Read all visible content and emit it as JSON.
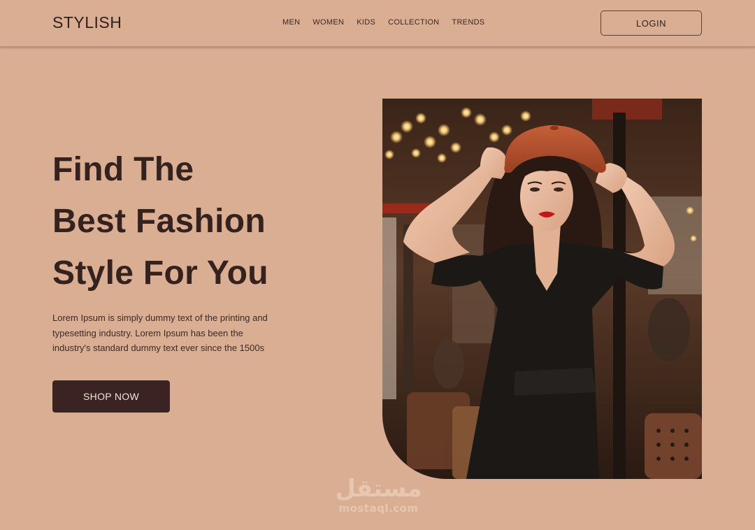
{
  "header": {
    "logo": "STYLISH",
    "nav": [
      {
        "label": "MEN"
      },
      {
        "label": "WOMEN"
      },
      {
        "label": "KIDS"
      },
      {
        "label": "COLLECTION"
      },
      {
        "label": "TRENDS"
      }
    ],
    "login_label": "LOGIN"
  },
  "hero": {
    "headline_lines": [
      "Find The",
      "Best Fashion",
      "Style For You"
    ],
    "description_lines": [
      "Lorem Ipsum is simply dummy text of the printing and",
      "typesetting industry. Lorem Ipsum has been the",
      "industry's standard dummy text ever since the 1500s"
    ],
    "cta_label": "SHOP NOW",
    "image_subject": "woman-in-black-dress-and-orange-beret-photo"
  },
  "watermark": {
    "arabic": "مستقل",
    "latin": "mostaql.com"
  },
  "colors": {
    "background": "#d9ae92",
    "text_dark": "#35221f",
    "button_dark": "#3a2322",
    "beret": "#b5502c",
    "lips": "#c4161c"
  }
}
